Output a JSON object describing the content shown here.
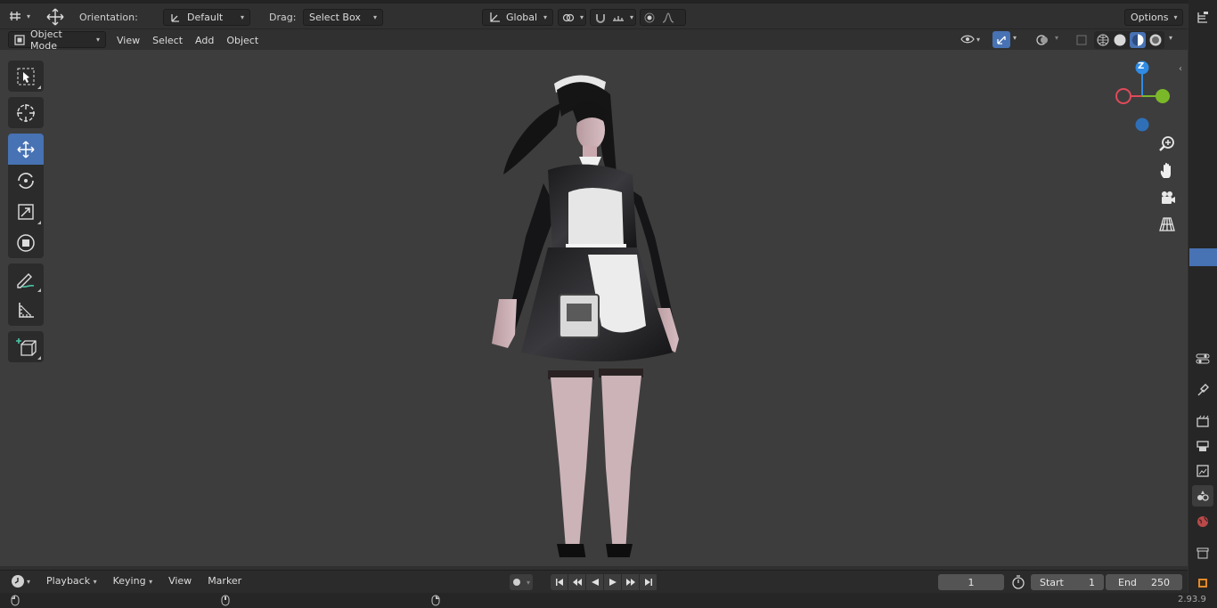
{
  "header": {
    "orientation_label": "Orientation:",
    "orientation_value": "Default",
    "drag_label": "Drag:",
    "drag_value": "Select Box",
    "transform_value": "Global",
    "options_label": "Options"
  },
  "header2": {
    "mode": "Object Mode",
    "menus": [
      "View",
      "Select",
      "Add",
      "Object"
    ]
  },
  "gizmo": {
    "z_label": "Z"
  },
  "timeline": {
    "menus": [
      "Playback",
      "Keying",
      "View",
      "Marker"
    ],
    "current_frame": "1",
    "start_label": "Start",
    "start_value": "1",
    "end_label": "End",
    "end_value": "250"
  },
  "status": {
    "version": "2.93.9"
  },
  "colors": {
    "accent": "#4772b3",
    "axis_x": "#e04a5a",
    "axis_y": "#7ab829",
    "axis_z": "#2f8be4"
  }
}
